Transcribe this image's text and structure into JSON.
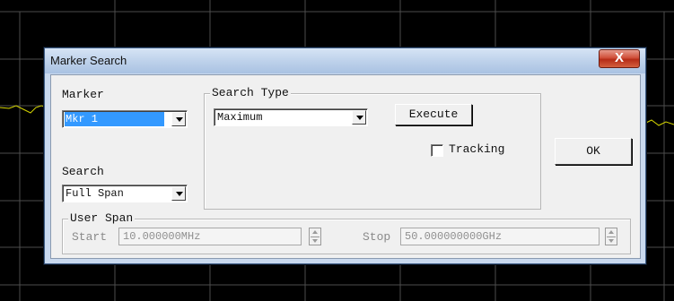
{
  "window": {
    "title": "Marker Search",
    "close_glyph": "X"
  },
  "marker": {
    "label": "Marker",
    "value": "Mkr 1"
  },
  "search": {
    "label": "Search",
    "value": "Full Span"
  },
  "search_type": {
    "group_label": "Search Type",
    "value": "Maximum"
  },
  "buttons": {
    "execute": "Execute",
    "ok": "OK"
  },
  "tracking": {
    "label": "Tracking",
    "checked": false
  },
  "user_span": {
    "group_label": "User Span",
    "start_label": "Start",
    "start_value": "10.000000MHz",
    "stop_label": "Stop",
    "stop_value": "50.000000000GHz"
  },
  "colors": {
    "background": "#000000",
    "grid": "#4d4d4d",
    "trace": "#d6d600",
    "selection": "#3399ff"
  }
}
